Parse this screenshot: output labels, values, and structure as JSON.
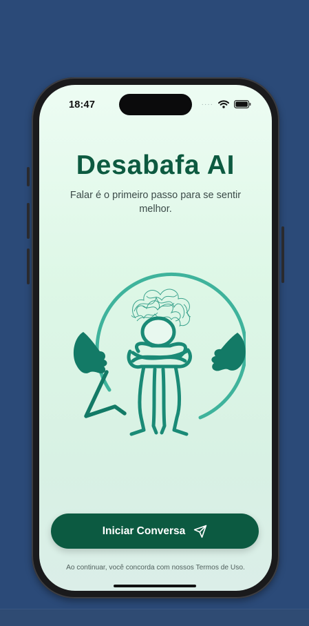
{
  "status_bar": {
    "time": "18:47",
    "signal": "····"
  },
  "app": {
    "title": "Desabafa AI",
    "subtitle": "Falar é o primeiro passo para se sentir melhor."
  },
  "illustration": {
    "icon": "person-hugging-knees-speech-bubble"
  },
  "cta": {
    "label": "Iniciar Conversa",
    "icon": "send-icon"
  },
  "footer": {
    "terms": "Ao continuar, você concorda com nossos Termos de Uso."
  },
  "colors": {
    "background": "#2b4a78",
    "primary": "#0c5a41",
    "teal": "#137a66",
    "ring": "#3fb39c"
  }
}
